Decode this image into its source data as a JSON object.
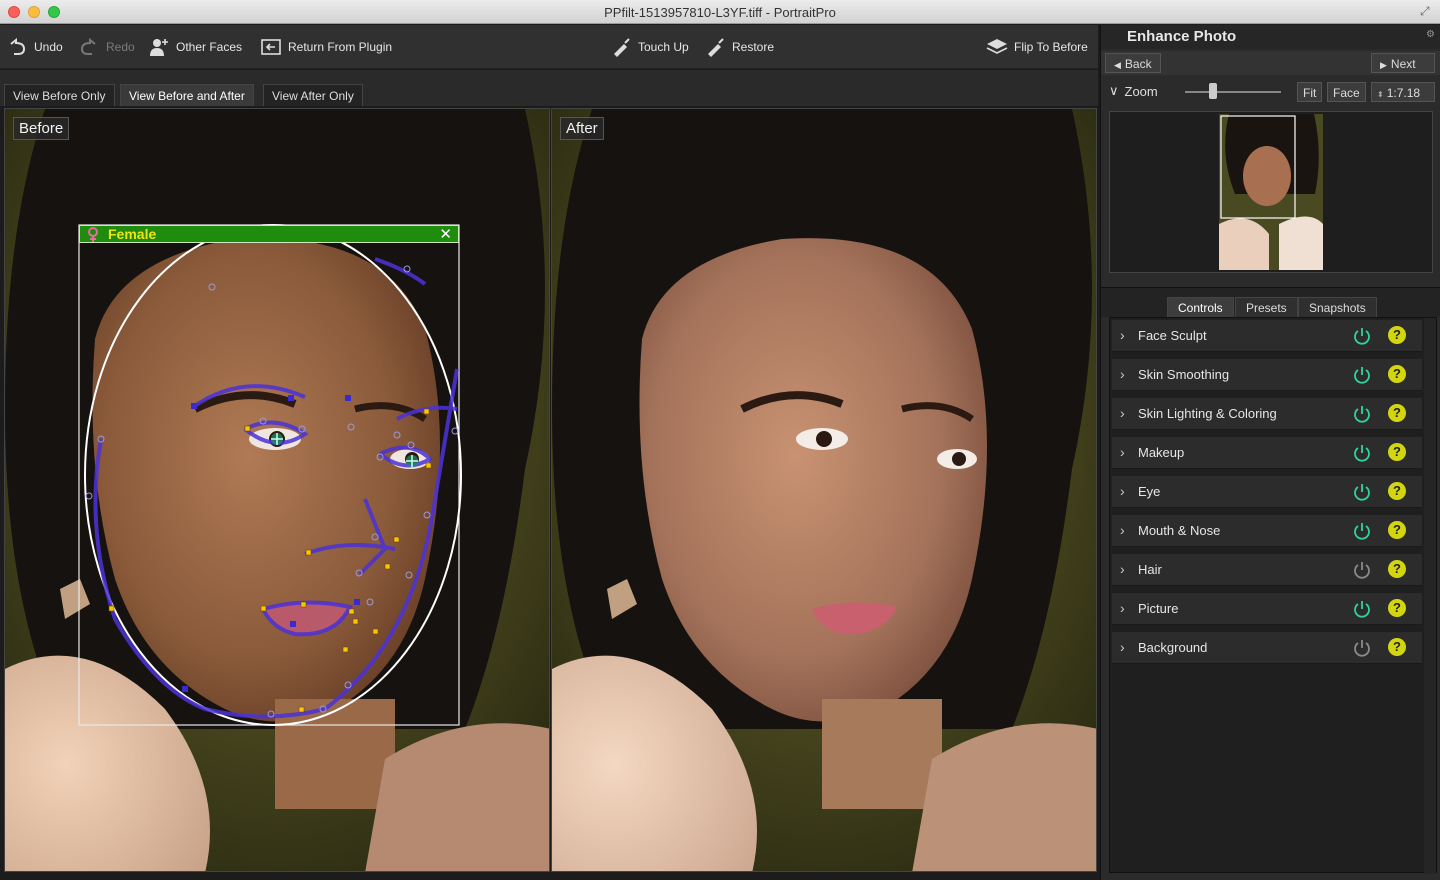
{
  "window": {
    "title": "PPfilt-1513957810-L3YF.tiff - PortraitPro"
  },
  "toolbar": {
    "undo": "Undo",
    "redo": "Redo",
    "other_faces": "Other Faces",
    "return_from_plugin": "Return From Plugin",
    "touch_up": "Touch Up",
    "restore": "Restore",
    "flip_to_before": "Flip To Before"
  },
  "view_tabs": {
    "before_only": "View Before Only",
    "before_and_after": "View Before and After",
    "after_only": "View After Only",
    "active": "View Before and After"
  },
  "panes": {
    "before_label": "Before",
    "after_label": "After",
    "face_tag": "Female"
  },
  "right_panel": {
    "title": "Enhance Photo",
    "back": "Back",
    "next": "Next",
    "zoom_label": "Zoom",
    "fit": "Fit",
    "face": "Face",
    "zoom_value": "1:7.18",
    "tabs": {
      "controls": "Controls",
      "presets": "Presets",
      "snapshots": "Snapshots"
    },
    "controls": [
      {
        "label": "Face Sculpt",
        "enabled": true
      },
      {
        "label": "Skin Smoothing",
        "enabled": true
      },
      {
        "label": "Skin Lighting & Coloring",
        "enabled": true
      },
      {
        "label": "Makeup",
        "enabled": true
      },
      {
        "label": "Eye",
        "enabled": true
      },
      {
        "label": "Mouth & Nose",
        "enabled": true
      },
      {
        "label": "Hair",
        "enabled": false
      },
      {
        "label": "Picture",
        "enabled": true
      },
      {
        "label": "Background",
        "enabled": false
      }
    ],
    "help_glyph": "?"
  },
  "colors": {
    "power_on": "#2fd3a0",
    "power_off": "#8a8a8a",
    "help": "#d3d60f",
    "face_tag_bg": "#1f8c0e",
    "face_tag_text": "#f0e21a",
    "landmark_line": "#4b32d8",
    "landmark_point_yellow": "#ffc400"
  }
}
